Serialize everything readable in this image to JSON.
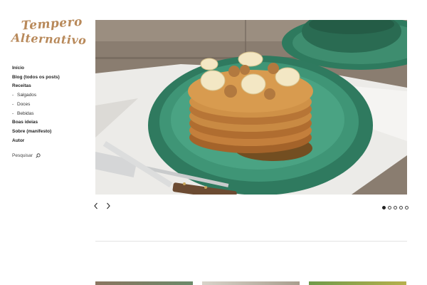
{
  "site": {
    "logo_line1": "Tempero",
    "logo_line2": "Alternativo"
  },
  "nav": {
    "items": [
      {
        "label": "Início",
        "level": 0
      },
      {
        "label": "Blog (todos os posts)",
        "level": 0
      },
      {
        "label": "Receitas",
        "level": 0
      },
      {
        "label": "Salgados",
        "level": 1
      },
      {
        "label": "Doces",
        "level": 1
      },
      {
        "label": "Bebidas",
        "level": 1
      },
      {
        "label": "Boas ideias",
        "level": 0
      },
      {
        "label": "Sobre (manifesto)",
        "level": 0
      },
      {
        "label": "Autor",
        "level": 0
      }
    ],
    "sub_prefix": "-"
  },
  "search": {
    "label": "Pesquisar",
    "icon": "search-icon"
  },
  "slider": {
    "slide_count": 5,
    "active_index": 0,
    "prev_icon": "chevron-left-icon",
    "next_icon": "chevron-right-icon"
  },
  "colors": {
    "logo": "#b8895a",
    "plate": "#3f8f6e",
    "pancake": "#c98a43"
  }
}
